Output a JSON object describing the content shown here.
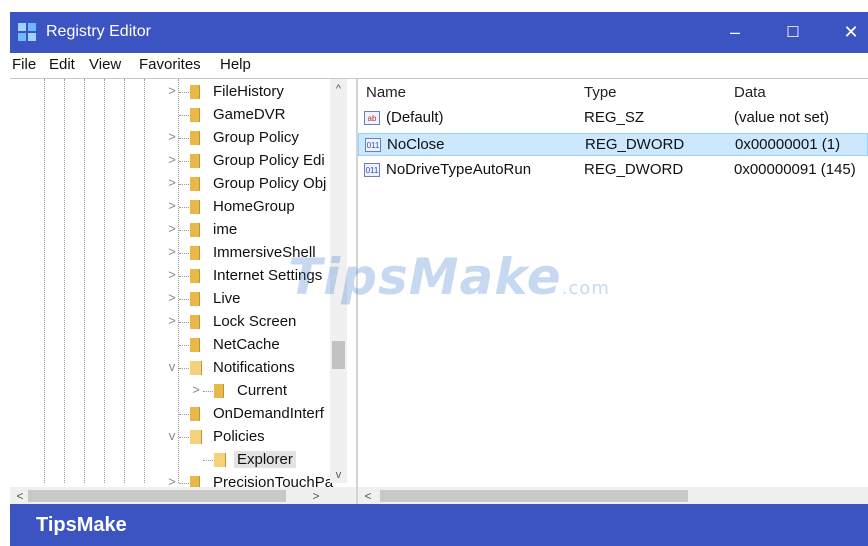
{
  "window": {
    "title": "Registry Editor",
    "minimize": "–",
    "maximize": "☐",
    "close": "✕"
  },
  "menu": [
    "File",
    "Edit",
    "View",
    "Favorites",
    "Help"
  ],
  "tree": {
    "items": [
      {
        "label": "FileHistory",
        "expander": ">"
      },
      {
        "label": "GameDVR",
        "expander": ""
      },
      {
        "label": "Group Policy",
        "expander": ">"
      },
      {
        "label": "Group Policy Edi",
        "expander": ">"
      },
      {
        "label": "Group Policy Obj",
        "expander": ">"
      },
      {
        "label": "HomeGroup",
        "expander": ">"
      },
      {
        "label": "ime",
        "expander": ">"
      },
      {
        "label": "ImmersiveShell",
        "expander": ">"
      },
      {
        "label": "Internet Settings",
        "expander": ">"
      },
      {
        "label": "Live",
        "expander": ">"
      },
      {
        "label": "Lock Screen",
        "expander": ">"
      },
      {
        "label": "NetCache",
        "expander": ""
      },
      {
        "label": "Notifications",
        "expander": "v"
      },
      {
        "label": "Current",
        "expander": ">"
      },
      {
        "label": "OnDemandInterf",
        "expander": ""
      },
      {
        "label": "Policies",
        "expander": "v"
      },
      {
        "label": "Explorer",
        "expander": ""
      },
      {
        "label": "PrecisionTouchPa",
        "expander": ">"
      }
    ],
    "scroll_up": "^",
    "scroll_down": "v",
    "scroll_left": "<",
    "scroll_right": ">"
  },
  "values": {
    "columns": {
      "name": "Name",
      "type": "Type",
      "data": "Data"
    },
    "rows": [
      {
        "name": "(Default)",
        "type": "REG_SZ",
        "data": "(value not set)",
        "icon": "ab"
      },
      {
        "name": "NoClose",
        "type": "REG_DWORD",
        "data": "0x00000001 (1)",
        "icon": "dword"
      },
      {
        "name": "NoDriveTypeAutoRun",
        "type": "REG_DWORD",
        "data": "0x00000091 (145)",
        "icon": "dword"
      }
    ],
    "scroll_left": "<"
  },
  "watermark": {
    "text": "TipsMake",
    "domain": ".com"
  },
  "footer": {
    "brand": "TipsMake"
  },
  "colors": {
    "titlebar": "#3c53c2",
    "selection": "#cce8ff",
    "folder": "#e8b84a"
  }
}
